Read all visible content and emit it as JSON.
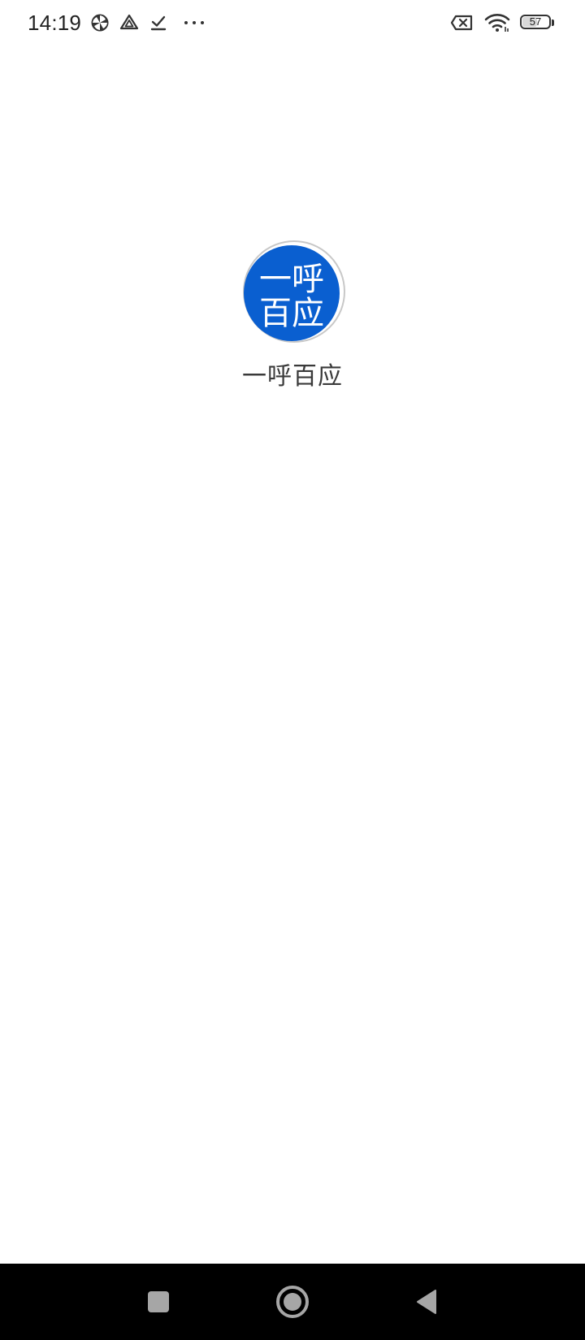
{
  "status_bar": {
    "time": "14:19",
    "battery_level": "57",
    "battery_fraction": 0.57,
    "left_icons": [
      "pinwheel-icon",
      "drive-icon",
      "download-done-icon",
      "more-dots-icon"
    ],
    "right_icons": [
      "no-sim-icon",
      "wifi-icon",
      "battery-icon"
    ]
  },
  "splash": {
    "logo_line1": "一呼",
    "logo_line2": "百应",
    "app_name": "一呼百应",
    "logo_color": "#0a5fd0"
  },
  "nav_bar": {
    "buttons": [
      "recents-button",
      "home-button",
      "back-button"
    ]
  }
}
